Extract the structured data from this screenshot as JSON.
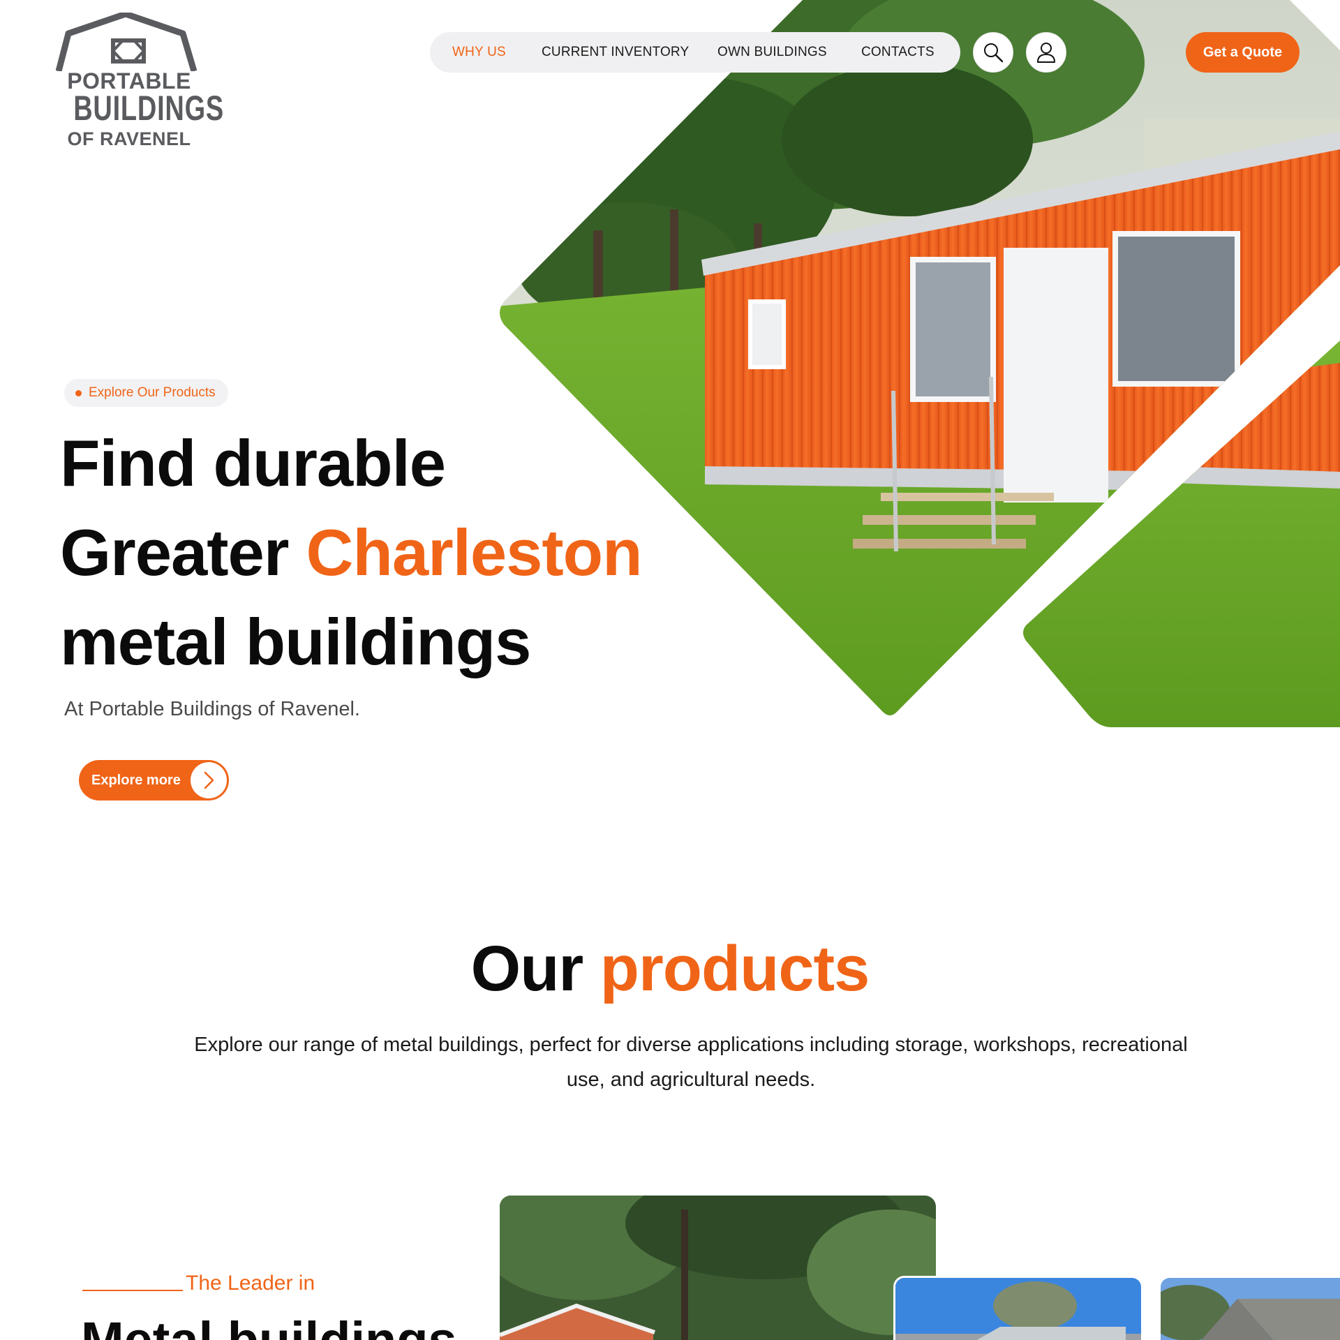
{
  "brand": {
    "line1": "PORTABLE",
    "line2": "BUILDINGS",
    "line3": "OF RAVENEL"
  },
  "nav": {
    "items": [
      {
        "label": "WHY US",
        "active": true
      },
      {
        "label": "CURRENT INVENTORY",
        "active": false
      },
      {
        "label": "OWN BUILDINGS",
        "active": false
      },
      {
        "label": "CONTACTS",
        "active": false
      }
    ],
    "search_icon": "search-icon",
    "user_icon": "user-icon",
    "cta_label": "Get a Quote"
  },
  "hero": {
    "chip": "Explore Our Products",
    "title_line1": "Find durable",
    "title_line2_a": "Greater ",
    "title_line2_b": "Charleston",
    "title_line3": "metal buildings",
    "subtitle": "At Portable Buildings of Ravenel.",
    "button_label": "Explore more",
    "button_icon": "chevron-right-icon"
  },
  "products": {
    "title_a": "Our ",
    "title_b": "products",
    "description": "Explore our range of metal buildings, perfect for diverse applications including storage, workshops, recreational use, and agricultural needs.",
    "eyebrow": "The Leader in",
    "heading": "Metal buildings"
  },
  "colors": {
    "accent": "#f06417",
    "text": "#0b0b0b",
    "nav_bg": "#f0f0f2"
  }
}
